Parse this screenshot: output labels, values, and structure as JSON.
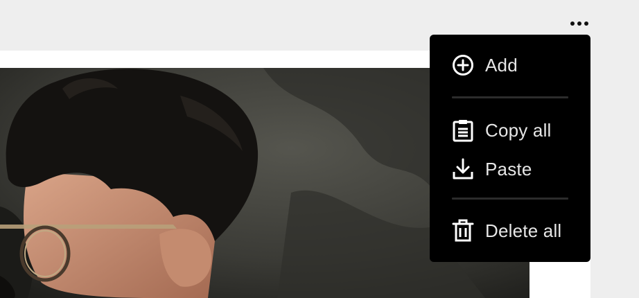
{
  "toolbar": {
    "more_icon": "more-horizontal-icon"
  },
  "image": {
    "subject": "photo-icon"
  },
  "menu": {
    "items": [
      {
        "label": "Add",
        "icon": "plus-circle-icon"
      },
      {
        "label": "Copy all",
        "icon": "clipboard-icon"
      },
      {
        "label": "Paste",
        "icon": "download-icon"
      },
      {
        "label": "Delete all",
        "icon": "trash-icon"
      }
    ]
  },
  "colors": {
    "page_background": "#eeeeee",
    "card_background": "#ffffff",
    "menu_background": "#000000",
    "menu_text": "#e6e6e6",
    "separator": "#2c2c2c"
  }
}
